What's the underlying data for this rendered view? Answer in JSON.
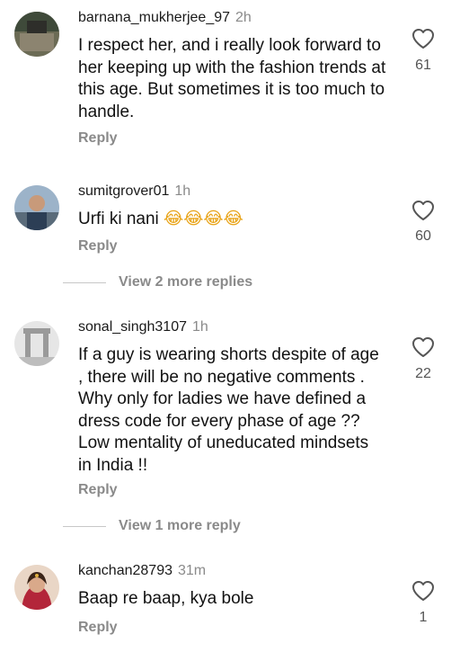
{
  "comments": [
    {
      "username": "barnana_mukherjee_97",
      "time": "2h",
      "text": "I respect her, and i really look forward to her keeping up with the fashion trends at this age. But sometimes it is too much to handle.",
      "reply_label": "Reply",
      "likes": "61"
    },
    {
      "username": "sumitgrover01",
      "time": "1h",
      "text": "Urfi ki nani",
      "emojis": "😂😂😂😂",
      "reply_label": "Reply",
      "likes": "60",
      "view_more": "View 2 more replies"
    },
    {
      "username": "sonal_singh3107",
      "time": "1h",
      "text": "If a guy is wearing shorts despite of age , there will be no negative comments . Why only for ladies we have defined a dress code for every phase of age ?? Low mentality of uneducated mindsets in India !!",
      "reply_label": "Reply",
      "likes": "22",
      "view_more": "View 1 more reply"
    },
    {
      "username": "kanchan28793",
      "time": "31m",
      "text": "Baap re baap, kya bole",
      "reply_label": "Reply",
      "likes": "1"
    }
  ],
  "icons": {
    "like": "heart-outline-icon"
  },
  "colors": {
    "secondary_text": "#8a8a8a",
    "primary_text": "#111111"
  }
}
